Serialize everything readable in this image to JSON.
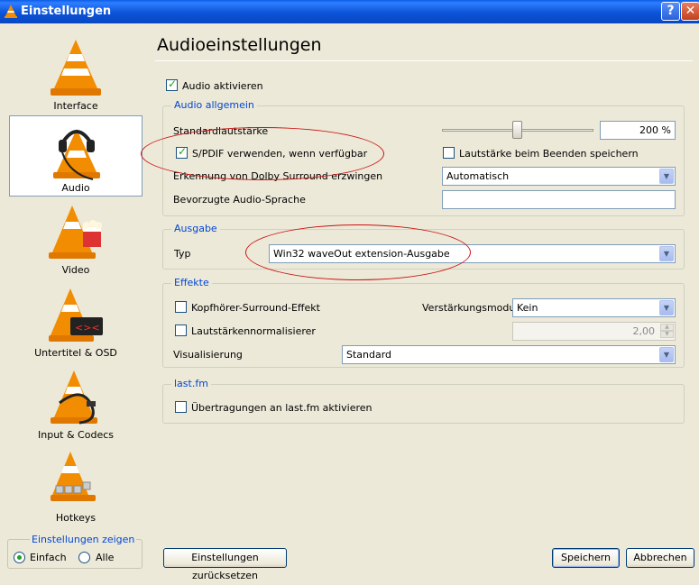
{
  "window": {
    "title": "Einstellungen",
    "help_glyph": "?",
    "close_glyph": "✕"
  },
  "nav": {
    "items": [
      {
        "label": "Interface"
      },
      {
        "label": "Audio"
      },
      {
        "label": "Video"
      },
      {
        "label": "Untertitel & OSD"
      },
      {
        "label": "Input & Codecs"
      },
      {
        "label": "Hotkeys"
      }
    ],
    "selected": "Audio",
    "show_settings": {
      "legend": "Einstellungen zeigen",
      "simple": "Einfach",
      "all": "Alle",
      "selected": "Einfach"
    }
  },
  "panel": {
    "title": "Audioeinstellungen",
    "enable_audio": {
      "label": "Audio aktivieren",
      "checked": true
    },
    "general": {
      "legend": "Audio allgemein",
      "default_volume_label": "Standardlautstärke",
      "default_volume_value": "200 %",
      "volume_level_percent": 200,
      "spdif": {
        "label": "S/PDIF verwenden, wenn verfügbar",
        "checked": true
      },
      "save_volume": {
        "label": "Lautstärke beim Beenden speichern",
        "checked": false
      },
      "dolby_label": "Erkennung von Dolby Surround erzwingen",
      "dolby_value": "Automatisch",
      "language_label": "Bevorzugte Audio-Sprache",
      "language_value": ""
    },
    "output": {
      "legend": "Ausgabe",
      "type_label": "Typ",
      "type_value": "Win32 waveOut extension-Ausgabe"
    },
    "effects": {
      "legend": "Effekte",
      "headphone": {
        "label": "Kopfhörer-Surround-Effekt",
        "checked": false
      },
      "gain_label": "Verstärkungsmodus",
      "gain_value": "Kein",
      "normalizer": {
        "label": "Lautstärkennormalisierer",
        "checked": false
      },
      "normalizer_value": "2,00",
      "visualization_label": "Visualisierung",
      "visualization_value": "Standard"
    },
    "lastfm": {
      "legend": "last.fm",
      "submit": {
        "label": "Übertragungen an last.fm aktivieren",
        "checked": false
      }
    }
  },
  "buttons": {
    "reset": "Einstellungen zurücksetzen",
    "save": "Speichern",
    "cancel": "Abbrechen"
  },
  "annotations": {
    "color": "#cc1111"
  }
}
